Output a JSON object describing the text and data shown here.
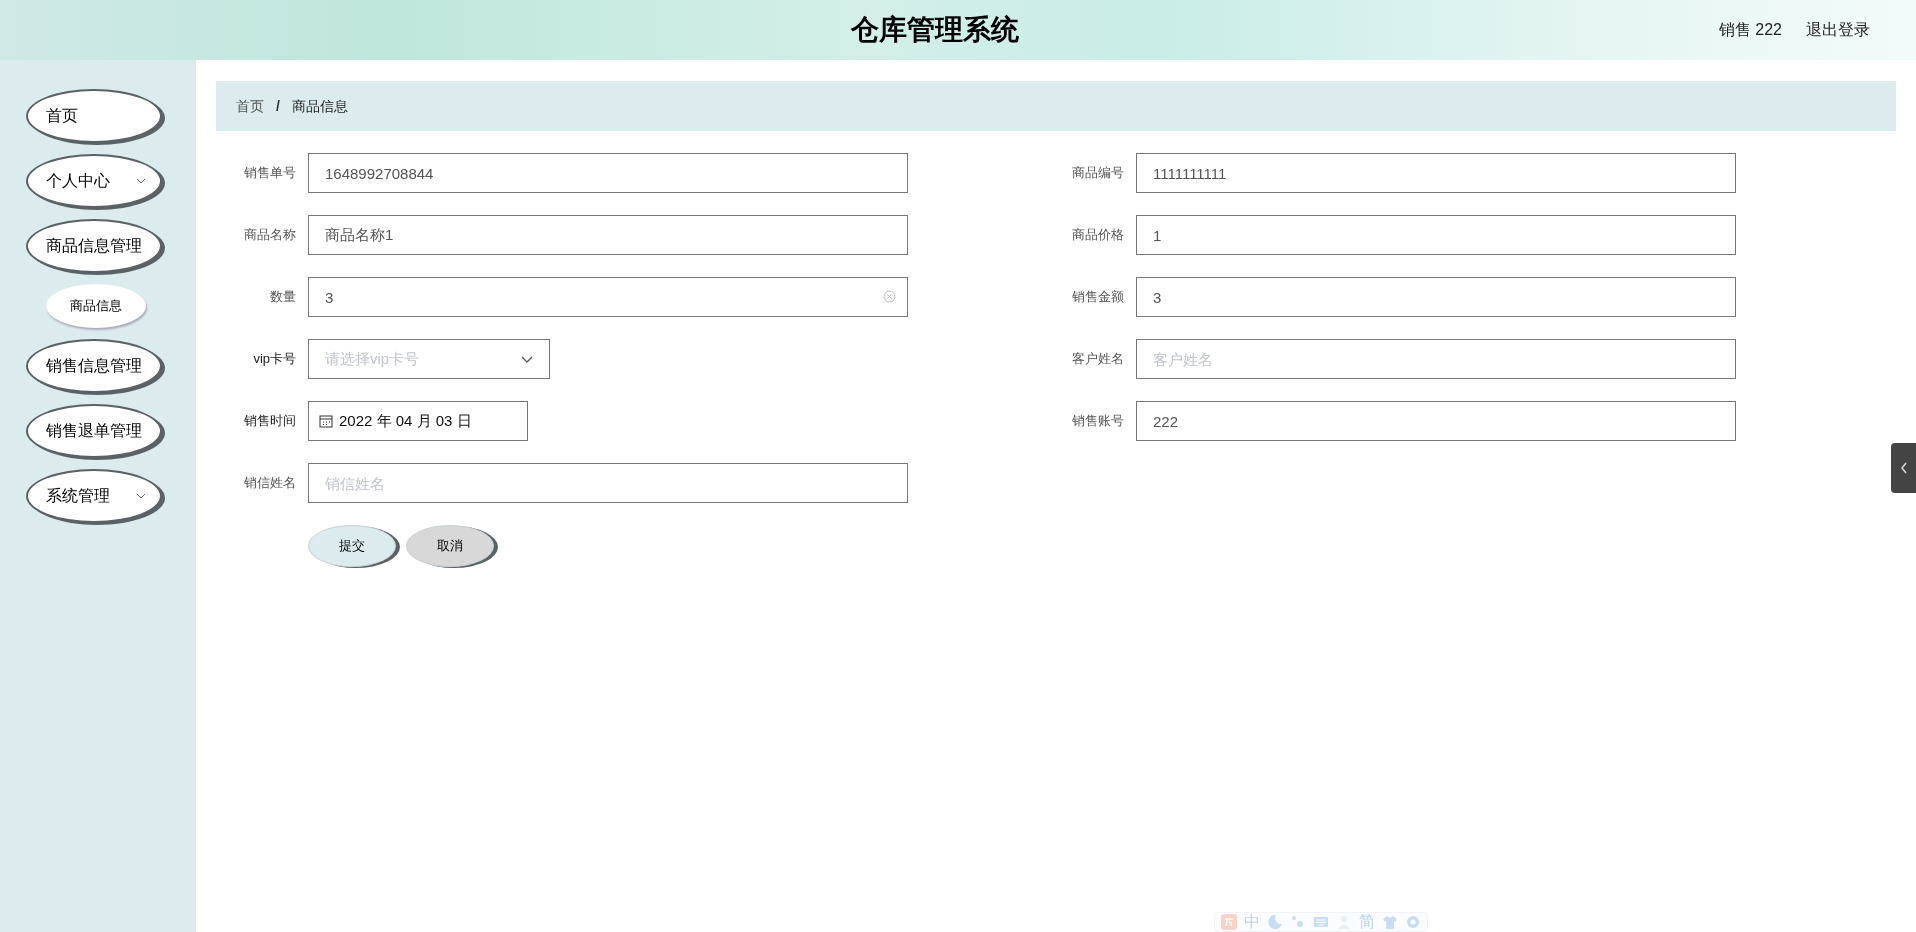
{
  "header": {
    "title": "仓库管理系统",
    "user": "销售 222",
    "logout": "退出登录"
  },
  "sidebar": {
    "items": [
      {
        "label": "首页",
        "kind": "link"
      },
      {
        "label": "个人中心",
        "kind": "menu"
      },
      {
        "label": "商品信息管理",
        "kind": "link",
        "children": [
          {
            "label": "商品信息"
          }
        ]
      },
      {
        "label": "销售信息管理",
        "kind": "link"
      },
      {
        "label": "销售退单管理",
        "kind": "link"
      },
      {
        "label": "系统管理",
        "kind": "menu"
      }
    ]
  },
  "breadcrumb": {
    "separator": "/",
    "items": [
      "首页",
      "商品信息"
    ]
  },
  "form": {
    "left": [
      {
        "label": "销售单号",
        "kind": "text",
        "value": "1648992708844"
      },
      {
        "label": "商品名称",
        "kind": "text",
        "value": "商品名称1"
      },
      {
        "label": "数量",
        "kind": "text",
        "value": "3",
        "clearable": true
      },
      {
        "label": "vip卡号",
        "kind": "select",
        "placeholder": "请选择vip卡号"
      },
      {
        "label": "销售时间",
        "kind": "date",
        "value": "2022 年 04 月 03 日"
      },
      {
        "label": "销信姓名",
        "kind": "text",
        "placeholder": "销信姓名"
      }
    ],
    "right": [
      {
        "label": "商品编号",
        "kind": "text",
        "value": "1111111111"
      },
      {
        "label": "商品价格",
        "kind": "text",
        "value": "1"
      },
      {
        "label": "销售金额",
        "kind": "text",
        "value": "3"
      },
      {
        "label": "客户姓名",
        "kind": "text",
        "placeholder": "客户姓名"
      },
      {
        "label": "销售账号",
        "kind": "text",
        "value": "222"
      }
    ],
    "buttons": [
      {
        "label": "提交",
        "kind": "primary"
      },
      {
        "label": "取消",
        "kind": "secondary"
      }
    ]
  },
  "ime_toolbar": {
    "items": [
      {
        "kind": "logo"
      },
      {
        "kind": "text",
        "label": "中"
      },
      {
        "kind": "moon"
      },
      {
        "kind": "dots"
      },
      {
        "kind": "keyboard"
      },
      {
        "kind": "person"
      },
      {
        "kind": "text",
        "label": "简"
      },
      {
        "kind": "shirt"
      },
      {
        "kind": "gear"
      }
    ]
  }
}
